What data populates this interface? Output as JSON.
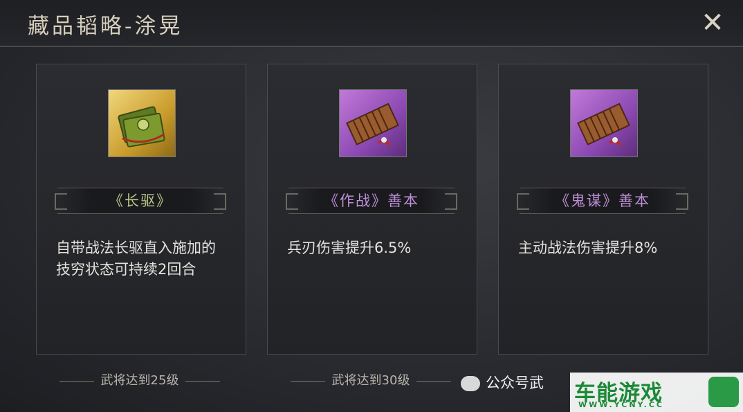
{
  "header": {
    "title": "藏品韬略-涂晃",
    "close_icon": "close-x-icon"
  },
  "cards": [
    {
      "icon": "green-scroll-icon",
      "rarity_color": "#c99c2c",
      "name": "《长驱》",
      "description": "自带战法长驱直入施加的技穷状态可持续2回合",
      "requirement": "武将达到25级"
    },
    {
      "icon": "bamboo-book-icon",
      "rarity_color": "#8c49b3",
      "name": "《作战》善本",
      "description": "兵刃伤害提升6.5%",
      "requirement": "武将达到30级"
    },
    {
      "icon": "bamboo-book-icon",
      "rarity_color": "#8c49b3",
      "name": "《鬼谋》善本",
      "description": "主动战法伤害提升8%",
      "requirement": ""
    }
  ],
  "watermark": {
    "wechat_text": "公众号武",
    "logo_text": "车能游戏",
    "logo_url": "WWW.YCNY.CC"
  }
}
